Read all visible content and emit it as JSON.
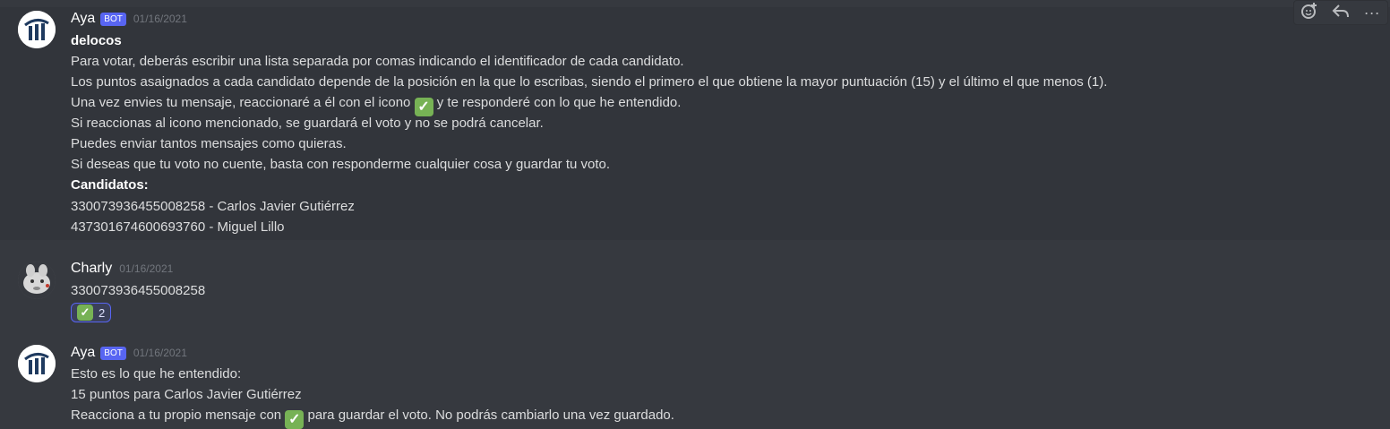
{
  "messages": [
    {
      "username": "Aya",
      "bot_tag": "BOT",
      "timestamp": "01/16/2021",
      "title": "delocos",
      "lines": [
        "Para votar, deberás escribir una lista separada por comas indicando el identificador de cada candidato.",
        "Los puntos asaignados a cada candidato depende de la posición en la que lo escribas, siendo el primero el que obtiene la mayor puntuación (15) y el último el que menos (1).",
        "Una vez envies tu mensaje, reaccionaré a él con el icono",
        "y te responderé con lo que he entendido.",
        "Si reaccionas al icono mencionado, se guardará el voto y no se podrá cancelar.",
        "Puedes enviar tantos mensajes como quieras.",
        "Si deseas que tu voto no cuente, basta con responderme cualquier cosa y guardar tu voto."
      ],
      "candidates_heading": "Candidatos:",
      "candidates": [
        "330073936455008258 - Carlos Javier Gutiérrez",
        "437301674600693760 - Miguel Lillo"
      ]
    },
    {
      "username": "Charly",
      "timestamp": "01/16/2021",
      "content": "330073936455008258",
      "reaction": {
        "emoji": "✅",
        "count": "2"
      }
    },
    {
      "username": "Aya",
      "bot_tag": "BOT",
      "timestamp": "01/16/2021",
      "lines": [
        "Esto es lo que he entendido:",
        "15 puntos para Carlos Javier Gutiérrez",
        "Reacciona a tu propio mensaje con",
        "para guardar el voto. No podrás cambiarlo una vez guardado."
      ]
    }
  ],
  "emoji_check": "✓",
  "toolbar": {
    "icons": [
      "add-reaction-icon",
      "reply-icon",
      "more-icon"
    ],
    "more_label": "···"
  },
  "colors": {
    "background": "#36393f",
    "hover": "#32353b",
    "bot_tag": "#5865f2",
    "checkmark": "#77b255"
  }
}
